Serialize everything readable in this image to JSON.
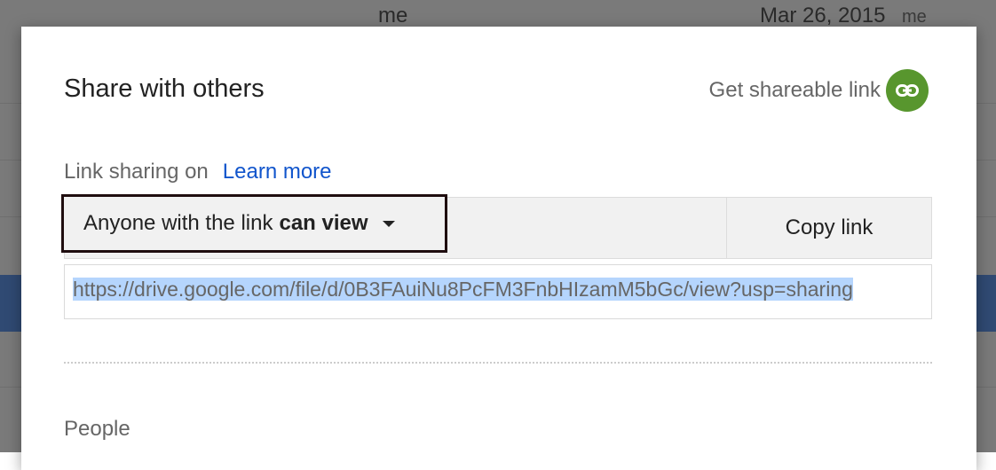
{
  "background": {
    "owner_text": "me",
    "date_text": "Mar 26, 2015",
    "modified_by_text": "me"
  },
  "dialog": {
    "title": "Share with others",
    "shareable_link_label": "Get shareable link",
    "status_text": "Link sharing on",
    "learn_more_label": "Learn more",
    "access_prefix": "Anyone with the link",
    "access_level": "can view",
    "copy_label": "Copy link",
    "url": "https://drive.google.com/file/d/0B3FAuiNu8PcFM3FnbHIzamM5bGc/view?usp=sharing",
    "people_label": "People"
  },
  "colors": {
    "accent_green": "#58962e",
    "link_blue": "#1155cc",
    "selection_blue": "#b5d5fd"
  }
}
